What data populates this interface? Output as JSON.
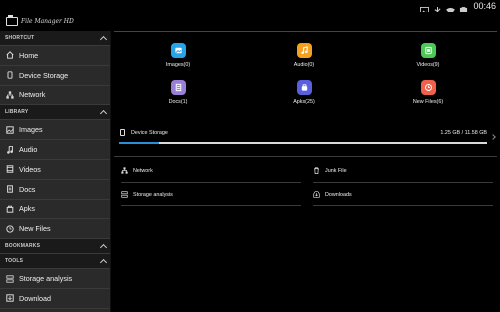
{
  "status_bar": {
    "time": "00:46",
    "icons": [
      "gallery-icon",
      "usb-icon",
      "wifi-icon",
      "battery-icon"
    ]
  },
  "app": {
    "title": "File Manager HD"
  },
  "sidebar": {
    "sections": [
      {
        "label": "SHORTCUT",
        "items": [
          {
            "label": "Home",
            "icon": "home-icon"
          },
          {
            "label": "Device Storage",
            "icon": "device-storage-icon"
          },
          {
            "label": "Network",
            "icon": "network-icon"
          }
        ]
      },
      {
        "label": "LIBRARY",
        "items": [
          {
            "label": "Images",
            "icon": "images-icon"
          },
          {
            "label": "Audio",
            "icon": "audio-icon"
          },
          {
            "label": "Videos",
            "icon": "videos-icon"
          },
          {
            "label": "Docs",
            "icon": "docs-icon"
          },
          {
            "label": "Apks",
            "icon": "apks-icon"
          },
          {
            "label": "New Files",
            "icon": "new-files-icon"
          }
        ]
      },
      {
        "label": "BOOKMARKS",
        "items": []
      },
      {
        "label": "TOOLS",
        "items": [
          {
            "label": "Storage analysis",
            "icon": "storage-analysis-icon"
          },
          {
            "label": "Download",
            "icon": "download-icon"
          }
        ]
      }
    ]
  },
  "categories": [
    {
      "label": "Images(0)",
      "icon": "images-icon",
      "color": "#29a3e8"
    },
    {
      "label": "Audio(0)",
      "icon": "audio-icon",
      "color": "#f5a020"
    },
    {
      "label": "Videos(9)",
      "icon": "videos-icon",
      "color": "#4fc85a"
    },
    {
      "label": "Docs(1)",
      "icon": "docs-icon",
      "color": "#9a7fd8"
    },
    {
      "label": "Apks(25)",
      "icon": "apks-icon",
      "color": "#5a5fe0"
    },
    {
      "label": "New Files(6)",
      "icon": "new-files-icon",
      "color": "#f0604a"
    }
  ],
  "storage": {
    "name": "Device Storage",
    "size": "1.25 GB / 11.58 GB",
    "used_fraction": 0.108,
    "bar_color": "#2a8fd6"
  },
  "tools": [
    {
      "label": "Network",
      "icon": "network-icon"
    },
    {
      "label": "Junk File",
      "icon": "trash-icon"
    },
    {
      "label": "Storage analysis",
      "icon": "storage-analysis-icon"
    },
    {
      "label": "Downloads",
      "icon": "download-icon"
    }
  ]
}
